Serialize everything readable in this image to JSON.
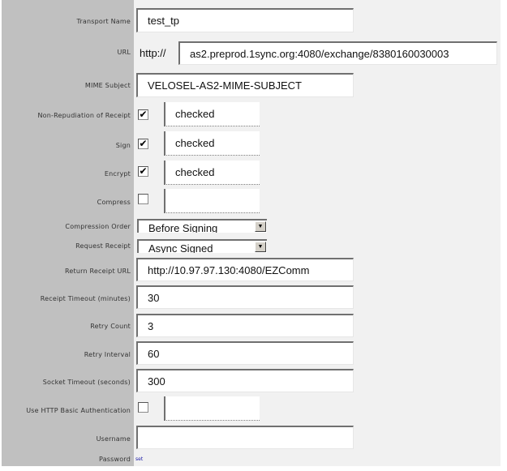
{
  "fields": {
    "transport_name": {
      "label": "Transport Name",
      "value": "test_tp"
    },
    "url": {
      "label": "URL",
      "prefix": "http://",
      "value": "as2.preprod.1sync.org:4080/exchange/8380160030003"
    },
    "mime_subject": {
      "label": "MIME Subject",
      "value": "VELOSEL-AS2-MIME-SUBJECT"
    },
    "non_repudiation": {
      "label": "Non-Repudiation of Receipt",
      "checked": true,
      "status": "checked"
    },
    "sign": {
      "label": "Sign",
      "checked": true,
      "status": "checked"
    },
    "encrypt": {
      "label": "Encrypt",
      "checked": true,
      "status": "checked"
    },
    "compress": {
      "label": "Compress",
      "checked": false,
      "status": ""
    },
    "compression_order": {
      "label": "Compression Order",
      "selected": "Before Signing"
    },
    "request_receipt": {
      "label": "Request Receipt",
      "selected": "Async Signed"
    },
    "return_receipt_url": {
      "label": "Return Receipt URL",
      "value": "http://10.97.97.130:4080/EZComm"
    },
    "receipt_timeout": {
      "label": "Receipt Timeout (minutes)",
      "value": "30"
    },
    "retry_count": {
      "label": "Retry Count",
      "value": "3"
    },
    "retry_interval": {
      "label": "Retry Interval",
      "value": "60"
    },
    "socket_timeout": {
      "label": "Socket Timeout (seconds)",
      "value": "300"
    },
    "http_basic_auth": {
      "label": "Use HTTP Basic Authentication",
      "checked": false,
      "status": ""
    },
    "username": {
      "label": "Username",
      "value": ""
    },
    "password": {
      "label": "Password",
      "link": "set"
    }
  },
  "icons": {
    "checkmark": "✔",
    "dropdown_arrow": "▼"
  }
}
